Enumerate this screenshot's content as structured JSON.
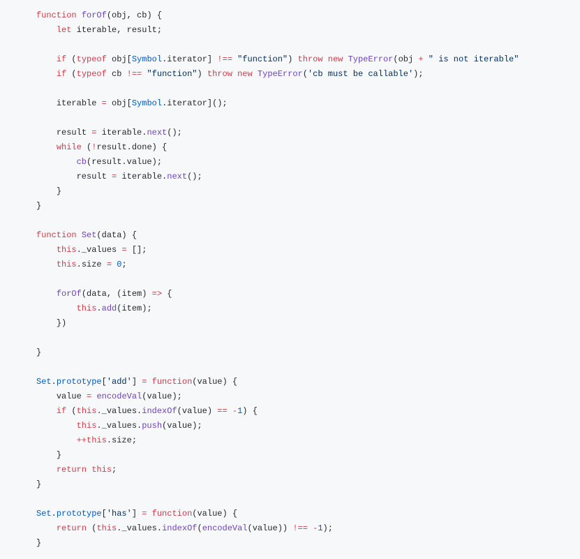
{
  "code": {
    "l1": {
      "a": "function",
      "b": "forOf",
      "c": "(obj, cb) {"
    },
    "l2": {
      "a": "let",
      "b": " iterable, result;"
    },
    "l3": "",
    "l4": {
      "a": "if",
      "b": " (",
      "c": "typeof",
      "d": " obj[",
      "e": "Symbol",
      "f": ".iterator] ",
      "g": "!==",
      "h": " ",
      "i": "\"function\"",
      "j": ") ",
      "k": "throw",
      "l": " ",
      "m": "new",
      "n": " ",
      "o": "TypeError",
      "p": "(obj ",
      "q": "+",
      "r": " ",
      "s": "\" is not iterable\""
    },
    "l5": {
      "a": "if",
      "b": " (",
      "c": "typeof",
      "d": " cb ",
      "e": "!==",
      "f": " ",
      "g": "\"function\"",
      "h": ") ",
      "i": "throw",
      "j": " ",
      "k": "new",
      "l": " ",
      "m": "TypeError",
      "n": "(",
      "o": "'cb must be callable'",
      "p": ");"
    },
    "l6": "",
    "l7": {
      "a": "iterable ",
      "b": "=",
      "c": " obj[",
      "d": "Symbol",
      "e": ".iterator]();"
    },
    "l8": "",
    "l9": {
      "a": "result ",
      "b": "=",
      "c": " iterable.",
      "d": "next",
      "e": "();"
    },
    "l10": {
      "a": "while",
      "b": " (",
      "c": "!",
      "d": "result.done) {"
    },
    "l11": {
      "a": "cb",
      "b": "(result.value);"
    },
    "l12": {
      "a": "result ",
      "b": "=",
      "c": " iterable.",
      "d": "next",
      "e": "();"
    },
    "l13": "}",
    "l14": "}",
    "l15": "",
    "l16": {
      "a": "function",
      "b": "Set",
      "c": "(data) {"
    },
    "l17": {
      "a": "this",
      "b": "._values ",
      "c": "=",
      "d": " [];"
    },
    "l18": {
      "a": "this",
      "b": ".size ",
      "c": "=",
      "d": " ",
      "e": "0",
      "f": ";"
    },
    "l19": "",
    "l20": {
      "a": "forOf",
      "b": "(data, (item) ",
      "c": "=>",
      "d": " {"
    },
    "l21": {
      "a": "this",
      "b": ".",
      "c": "add",
      "d": "(item);"
    },
    "l22": "})",
    "l23": "",
    "l24": "}",
    "l25": "",
    "l26": {
      "a": "Set",
      "b": ".",
      "c": "prototype",
      "d": "[",
      "e": "'add'",
      "f": "] ",
      "g": "=",
      "h": " ",
      "i": "function",
      "j": "(value) {"
    },
    "l27": {
      "a": "value ",
      "b": "=",
      "c": " ",
      "d": "encodeVal",
      "e": "(value);"
    },
    "l28": {
      "a": "if",
      "b": " (",
      "c": "this",
      "d": "._values.",
      "e": "indexOf",
      "f": "(value) ",
      "g": "==",
      "h": " ",
      "i": "-",
      "j": "1",
      "k": ") {"
    },
    "l29": {
      "a": "this",
      "b": "._values.",
      "c": "push",
      "d": "(value);"
    },
    "l30": {
      "a": "++",
      "b": "this",
      "c": ".size;"
    },
    "l31": "}",
    "l32": {
      "a": "return",
      "b": " ",
      "c": "this",
      "d": ";"
    },
    "l33": "}",
    "l34": "",
    "l35": {
      "a": "Set",
      "b": ".",
      "c": "prototype",
      "d": "[",
      "e": "'has'",
      "f": "] ",
      "g": "=",
      "h": " ",
      "i": "function",
      "j": "(value) {"
    },
    "l36": {
      "a": "return",
      "b": " (",
      "c": "this",
      "d": "._values.",
      "e": "indexOf",
      "f": "(",
      "g": "encodeVal",
      "h": "(value)) ",
      "i": "!==",
      "j": " ",
      "k": "-",
      "l": "1",
      "m": ");"
    },
    "l37": "}"
  }
}
